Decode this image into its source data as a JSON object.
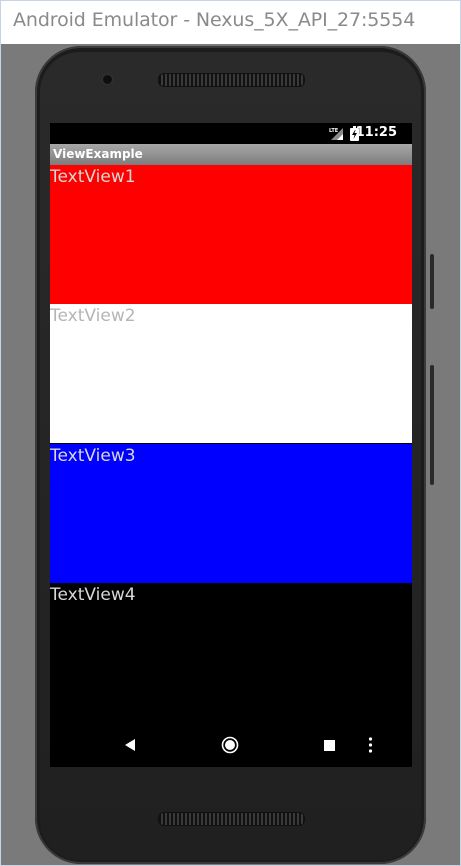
{
  "window": {
    "title": "Android Emulator - Nexus_5X_API_27:5554"
  },
  "status_bar": {
    "network": "LTE",
    "time": "11:25"
  },
  "action_bar": {
    "title": "ViewExample"
  },
  "text_views": [
    {
      "label": "TextView1",
      "background": "#ff0000"
    },
    {
      "label": "TextView2",
      "background": "#ffffff"
    },
    {
      "label": "TextView3",
      "background": "#0000ff"
    },
    {
      "label": "TextView4",
      "background": "#000000"
    }
  ],
  "nav_bar": {
    "icons": [
      "back-icon",
      "home-icon",
      "recents-icon",
      "menu-dots-icon"
    ]
  }
}
